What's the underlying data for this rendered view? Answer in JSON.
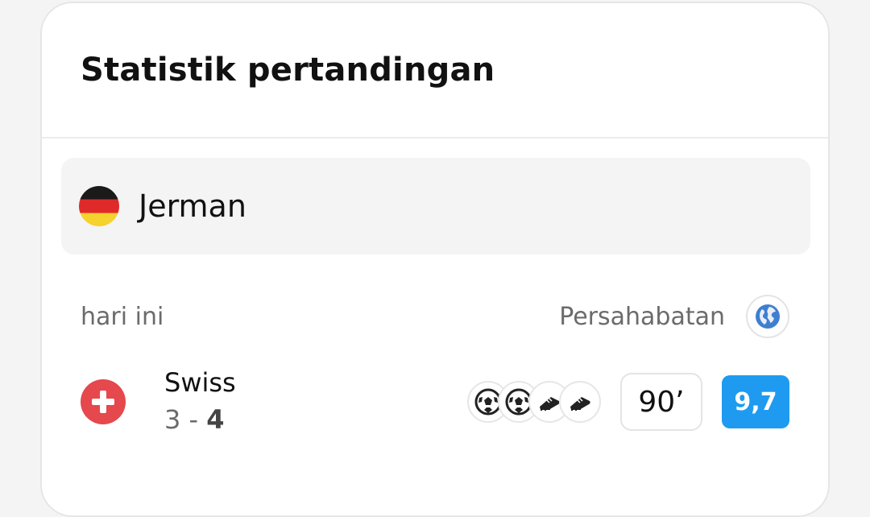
{
  "card": {
    "title": "Statistik pertandingan"
  },
  "team": {
    "name": "Jerman",
    "flag_icon": "germany-flag-icon"
  },
  "match_meta": {
    "date_label": "hari ini",
    "competition": "Persahabatan",
    "competition_icon": "globe-icon"
  },
  "match": {
    "opponent": "Swiss",
    "opponent_flag_icon": "switzerland-flag-icon",
    "score_home": "3",
    "score_separator": "-",
    "score_away": "4",
    "events": [
      "football-icon",
      "football-icon",
      "boot-icon",
      "boot-icon"
    ],
    "minutes_played": "90’",
    "rating": "9,7"
  },
  "colors": {
    "rating_bg": "#1e9bf0",
    "banner_bg": "#f4f4f4",
    "switzerland_red": "#e5484d"
  }
}
